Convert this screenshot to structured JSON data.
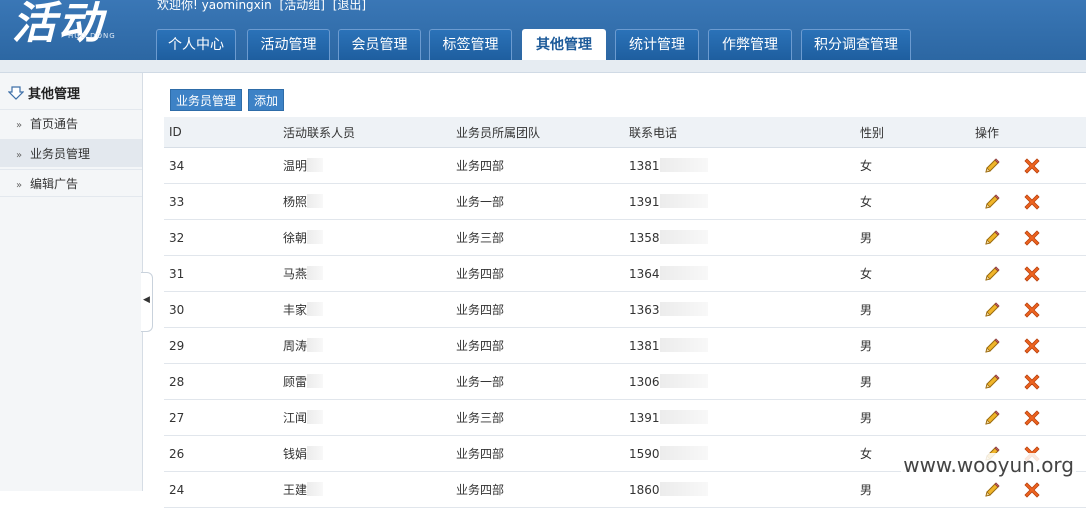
{
  "header": {
    "logo_text": "活动",
    "logo_sub": "HUO DONG",
    "welcome_text": "欢迎你! yaomingxin",
    "links": [
      "[活动组]",
      "[退出]"
    ]
  },
  "nav": {
    "tabs": [
      {
        "label": "个人中心",
        "active": false
      },
      {
        "label": "活动管理",
        "active": false
      },
      {
        "label": "会员管理",
        "active": false
      },
      {
        "label": "标签管理",
        "active": false
      },
      {
        "label": "其他管理",
        "active": true
      },
      {
        "label": "统计管理",
        "active": false
      },
      {
        "label": "作弊管理",
        "active": false
      },
      {
        "label": "积分调查管理",
        "active": false
      }
    ]
  },
  "sidebar": {
    "title": "其他管理",
    "items": [
      {
        "label": "首页通告",
        "active": false
      },
      {
        "label": "业务员管理",
        "active": true
      },
      {
        "label": "编辑广告",
        "active": false
      }
    ],
    "collapse_glyph": "◀"
  },
  "toolbar": {
    "manage_label": "业务员管理",
    "add_label": "添加"
  },
  "table": {
    "columns": [
      "ID",
      "活动联系人员",
      "业务员所属团队",
      "联系电话",
      "性别",
      "操作"
    ],
    "rows": [
      {
        "id": "34",
        "name": "温明",
        "team": "业务四部",
        "phone": "1381",
        "gender": "女"
      },
      {
        "id": "33",
        "name": "杨照",
        "team": "业务一部",
        "phone": "1391",
        "gender": "女"
      },
      {
        "id": "32",
        "name": "徐朝",
        "team": "业务三部",
        "phone": "1358",
        "gender": "男"
      },
      {
        "id": "31",
        "name": "马燕",
        "team": "业务四部",
        "phone": "1364",
        "gender": "女"
      },
      {
        "id": "30",
        "name": "丰家",
        "team": "业务四部",
        "phone": "1363",
        "gender": "男"
      },
      {
        "id": "29",
        "name": "周涛",
        "team": "业务四部",
        "phone": "1381",
        "gender": "男"
      },
      {
        "id": "28",
        "name": "顾雷",
        "team": "业务一部",
        "phone": "1306",
        "gender": "男"
      },
      {
        "id": "27",
        "name": "江闻",
        "team": "业务三部",
        "phone": "1391",
        "gender": "男"
      },
      {
        "id": "26",
        "name": "钱娟",
        "team": "业务四部",
        "phone": "1590",
        "gender": "女"
      },
      {
        "id": "24",
        "name": "王建",
        "team": "业务四部",
        "phone": "1860",
        "gender": "男"
      }
    ]
  },
  "watermark": "www.wooyun.org",
  "colors": {
    "header": "#2c67a3",
    "accent": "#3d82c6",
    "delete": "#e0541b",
    "edit": "#d49a1a"
  }
}
